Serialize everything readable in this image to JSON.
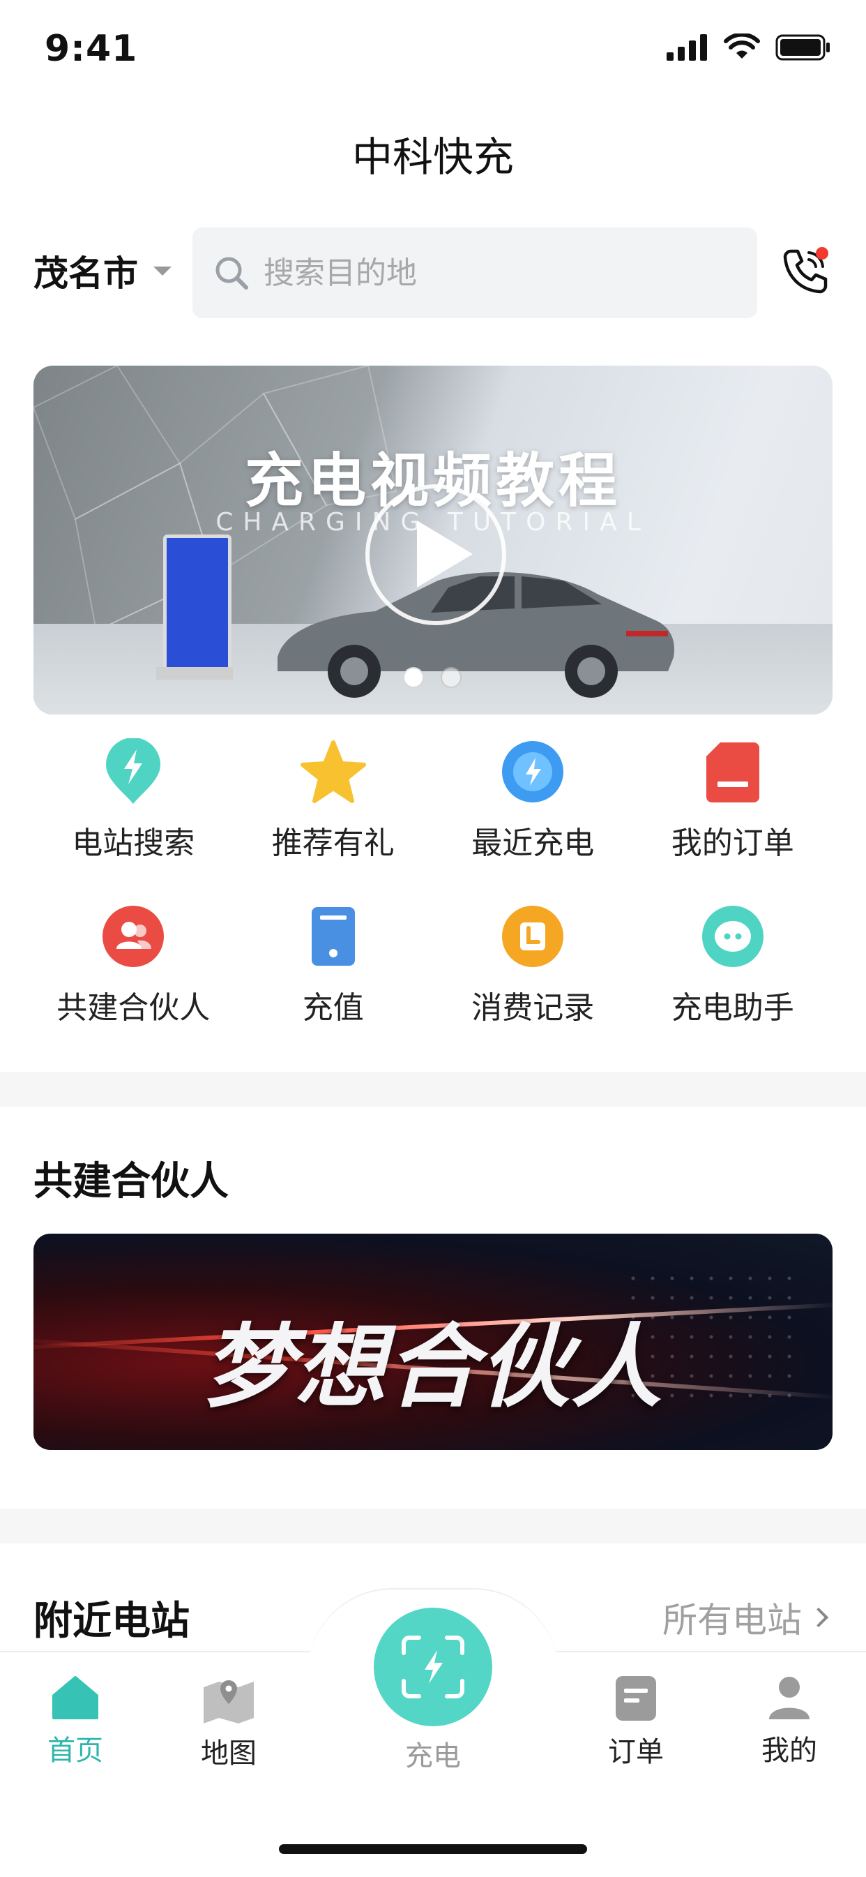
{
  "status": {
    "time": "9:41"
  },
  "header": {
    "title": "中科快充"
  },
  "location": {
    "city": "茂名市"
  },
  "search": {
    "placeholder": "搜索目的地"
  },
  "banner": {
    "title": "充电视频教程",
    "subtitle": "CHARGING TUTORIAL",
    "slides": 2,
    "active_slide": 1
  },
  "grid": {
    "items": [
      {
        "label": "电站搜索",
        "icon": "bolt-pin-icon",
        "color": "#4fd3c3"
      },
      {
        "label": "推荐有礼",
        "icon": "star-icon",
        "color": "#f7c12f"
      },
      {
        "label": "最近充电",
        "icon": "recent-charge-icon",
        "color": "#3d9bf2"
      },
      {
        "label": "我的订单",
        "icon": "order-card-icon",
        "color": "#ea4c44"
      },
      {
        "label": "共建合伙人",
        "icon": "partner-people-icon",
        "color": "#ea4c44"
      },
      {
        "label": "充值",
        "icon": "recharge-phone-icon",
        "color": "#4a90e2"
      },
      {
        "label": "消费记录",
        "icon": "consumption-record-icon",
        "color": "#f5a623"
      },
      {
        "label": "充电助手",
        "icon": "assistant-chat-icon",
        "color": "#4fd3c3"
      }
    ]
  },
  "partner_section": {
    "title": "共建合伙人",
    "banner_text": "梦想合伙人"
  },
  "nearby": {
    "title": "附近电站",
    "more_label": "所有电站"
  },
  "tabbar": {
    "items": [
      {
        "label": "首页",
        "active": true
      },
      {
        "label": "地图",
        "active": false
      },
      {
        "label": "充电",
        "active": false
      },
      {
        "label": "订单",
        "active": false
      },
      {
        "label": "我的",
        "active": false
      }
    ]
  },
  "colors": {
    "accent": "#2fb6ac",
    "fab": "#53d6c6",
    "alert_dot": "#f23a2e"
  }
}
